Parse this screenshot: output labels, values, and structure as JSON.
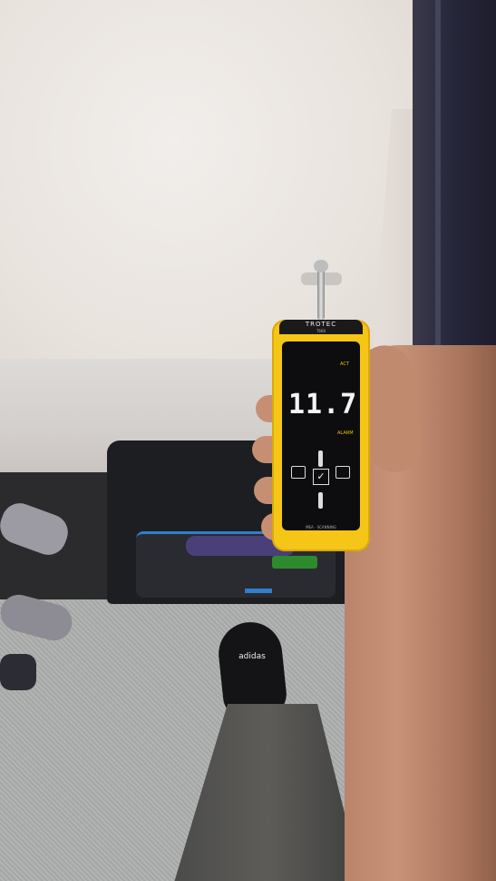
{
  "meter": {
    "brand": "TROTEC",
    "model": "T660",
    "mode_label": "ACT",
    "reading": "11.7",
    "status_label": "ALARM",
    "footer": "MEA · SCANNING"
  },
  "shoe_brand": "adidas"
}
